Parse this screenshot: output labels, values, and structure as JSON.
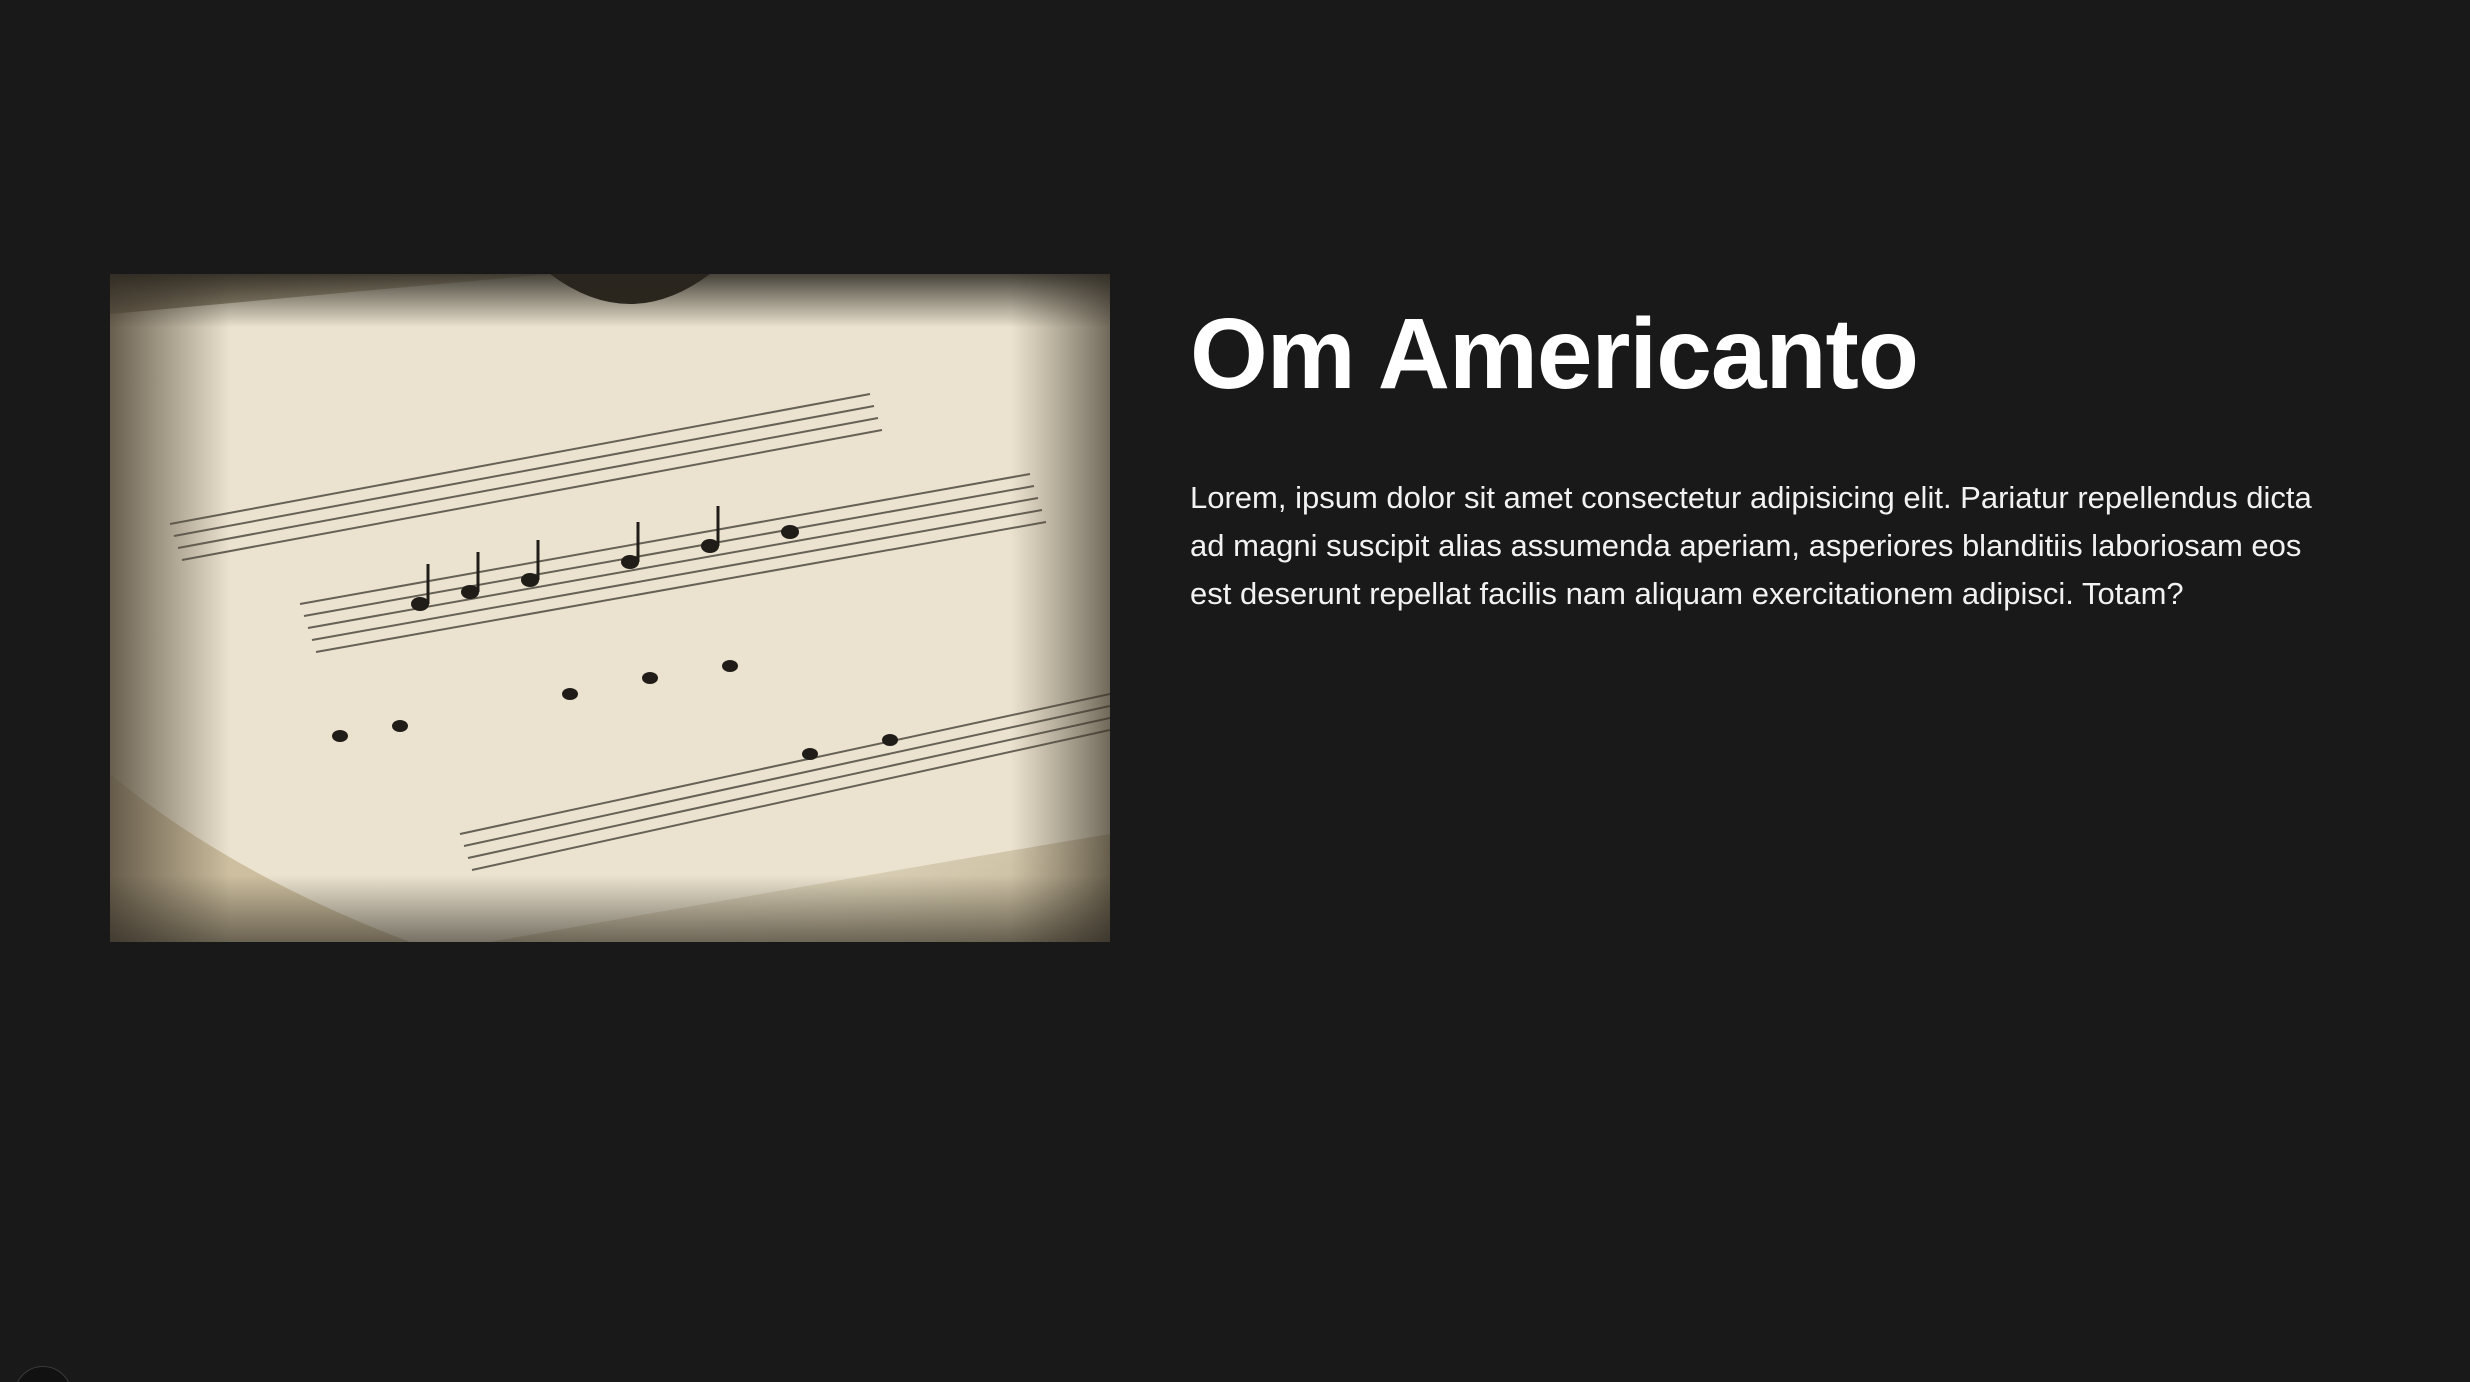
{
  "about": {
    "title": "Om Americanto",
    "body": "Lorem, ipsum dolor sit amet consectetur adipisicing elit. Pariatur repellendus dicta ad magni suscipit alias assumenda aperiam, asperiores blanditiis laboriosam eos est deserunt repellat facilis nam aliquam exercitationem adipisci. Totam?"
  },
  "image": {
    "subject": "sheet-music-photo"
  },
  "colors": {
    "background": "#191919",
    "text": "#ffffff",
    "paper": "#e6ddc6"
  }
}
